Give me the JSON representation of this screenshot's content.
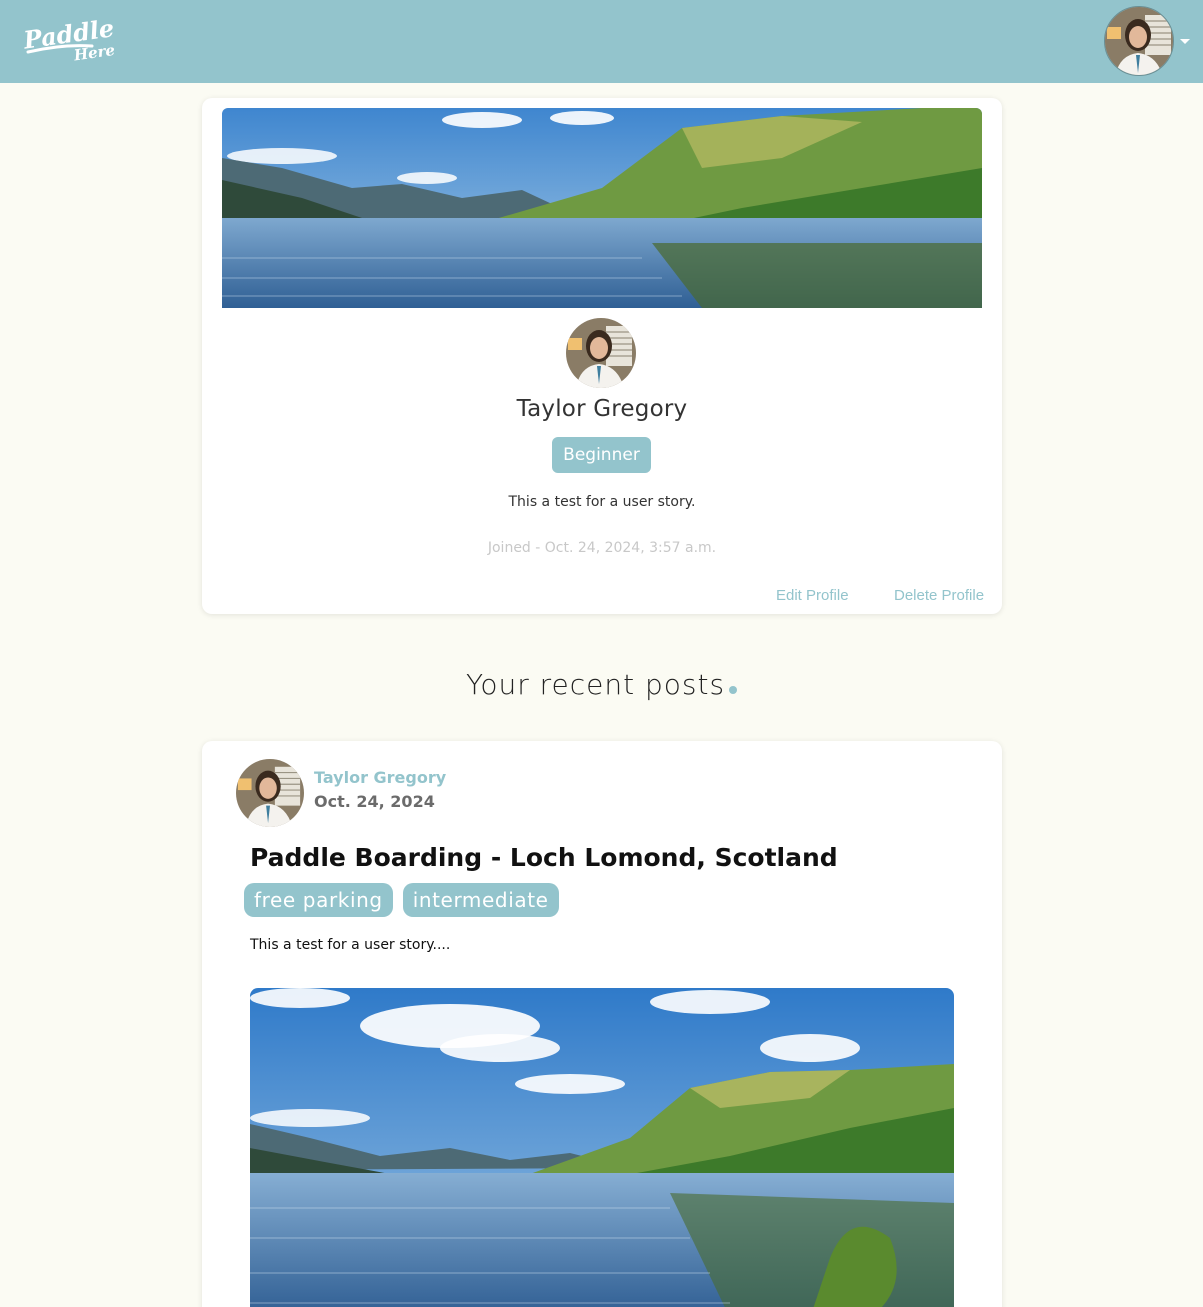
{
  "brand": {
    "logo_line1": "Paddle",
    "logo_line2": "Here",
    "accent_color": "#93c4cc"
  },
  "navbar": {
    "avatar_alt": "user avatar",
    "menu_icon": "caret-down-icon"
  },
  "profile": {
    "name": "Taylor Gregory",
    "level": "Beginner",
    "bio": "This a test for a user story.",
    "joined": "Joined - Oct. 24, 2024, 3:57 a.m.",
    "edit_label": "Edit Profile",
    "delete_label": "Delete Profile"
  },
  "recent": {
    "title": "Your recent posts"
  },
  "posts": [
    {
      "author": "Taylor Gregory",
      "date": "Oct. 24, 2024",
      "title": "Paddle Boarding - Loch Lomond, Scotland",
      "tags": [
        "free parking",
        "intermediate"
      ],
      "excerpt": "This a test for a user story...."
    }
  ]
}
